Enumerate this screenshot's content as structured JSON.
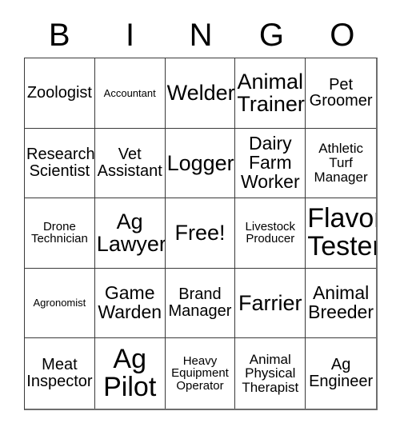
{
  "header": {
    "letters": [
      "B",
      "I",
      "N",
      "G",
      "O"
    ]
  },
  "grid": {
    "rows": 5,
    "columns": 5,
    "border_color": "#3a3a3a",
    "background_color": "#ffffff",
    "text_color": "#000000",
    "cells": [
      {
        "text": "Zoologist",
        "size": "md",
        "free": false
      },
      {
        "text": "Accountant",
        "size": "xxs",
        "free": false
      },
      {
        "text": "Welder",
        "size": "xl",
        "free": false
      },
      {
        "text": "Animal\nTrainer",
        "size": "xl",
        "free": false
      },
      {
        "text": "Pet\nGroomer",
        "size": "md",
        "free": false
      },
      {
        "text": "Research\nScientist",
        "size": "md",
        "free": false
      },
      {
        "text": "Vet\nAssistant",
        "size": "md",
        "free": false
      },
      {
        "text": "Logger",
        "size": "xl",
        "free": false
      },
      {
        "text": "Dairy\nFarm\nWorker",
        "size": "lg",
        "free": false
      },
      {
        "text": "Athletic\nTurf\nManager",
        "size": "sm",
        "free": false
      },
      {
        "text": "Drone\nTechnician",
        "size": "xs",
        "free": false
      },
      {
        "text": "Ag\nLawyer",
        "size": "xl",
        "free": false
      },
      {
        "text": "Free!",
        "size": "xl",
        "free": true
      },
      {
        "text": "Livestock\nProducer",
        "size": "xs",
        "free": false
      },
      {
        "text": "Flavor\nTester",
        "size": "xxl",
        "free": false
      },
      {
        "text": "Agronomist",
        "size": "xxs",
        "free": false
      },
      {
        "text": "Game\nWarden",
        "size": "lg",
        "free": false
      },
      {
        "text": "Brand\nManager",
        "size": "md",
        "free": false
      },
      {
        "text": "Farrier",
        "size": "xl",
        "free": false
      },
      {
        "text": "Animal\nBreeder",
        "size": "lg",
        "free": false
      },
      {
        "text": "Meat\nInspector",
        "size": "md",
        "free": false
      },
      {
        "text": "Ag\nPilot",
        "size": "xxl",
        "free": false
      },
      {
        "text": "Heavy\nEquipment\nOperator",
        "size": "xs",
        "free": false
      },
      {
        "text": "Animal\nPhysical\nTherapist",
        "size": "sm",
        "free": false
      },
      {
        "text": "Ag\nEngineer",
        "size": "md",
        "free": false
      }
    ]
  }
}
